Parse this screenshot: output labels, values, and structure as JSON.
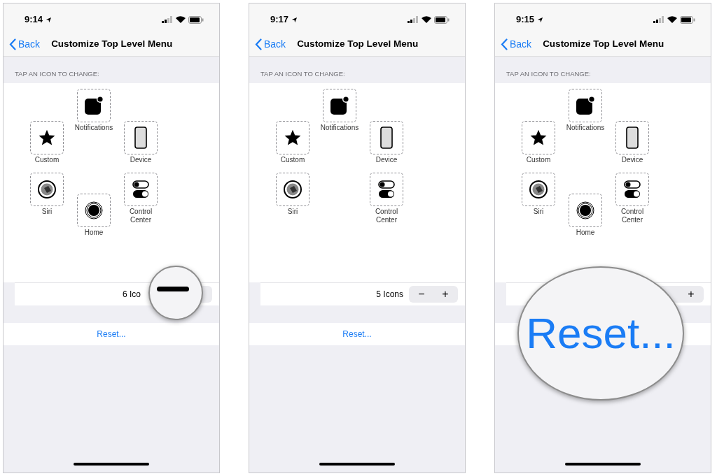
{
  "phones": [
    {
      "time": "9:14",
      "back": "Back",
      "title": "Customize Top Level Menu",
      "section_header": "TAP AN ICON TO CHANGE:",
      "icons": [
        {
          "kind": "notifications",
          "label": "Notifications"
        },
        {
          "kind": "custom",
          "label": "Custom"
        },
        {
          "kind": "device",
          "label": "Device"
        },
        {
          "kind": "siri",
          "label": "Siri"
        },
        {
          "kind": "control",
          "label": "Control Center"
        },
        {
          "kind": "home",
          "label": "Home"
        }
      ],
      "stepper": {
        "count": "6 Ico"
      },
      "reset": "Reset...",
      "magnifier": {
        "kind": "minus"
      }
    },
    {
      "time": "9:17",
      "back": "Back",
      "title": "Customize Top Level Menu",
      "section_header": "TAP AN ICON TO CHANGE:",
      "icons": [
        {
          "kind": "notifications",
          "label": "Notifications"
        },
        {
          "kind": "custom",
          "label": "Custom"
        },
        {
          "kind": "device",
          "label": "Device"
        },
        {
          "kind": "siri",
          "label": "Siri"
        },
        {
          "kind": "control",
          "label": "Control Center"
        }
      ],
      "stepper": {
        "count": "5 Icons",
        "minus": "−",
        "plus": "+"
      },
      "reset": "Reset..."
    },
    {
      "time": "9:15",
      "back": "Back",
      "title": "Customize Top Level Menu",
      "section_header": "TAP AN ICON TO CHANGE:",
      "icons": [
        {
          "kind": "notifications",
          "label": "Notifications"
        },
        {
          "kind": "custom",
          "label": "Custom"
        },
        {
          "kind": "device",
          "label": "Device"
        },
        {
          "kind": "siri",
          "label": "Siri"
        },
        {
          "kind": "control",
          "label": "Control Center"
        },
        {
          "kind": "home",
          "label": "Home"
        }
      ],
      "stepper": {
        "plus": "+"
      },
      "magnifier": {
        "kind": "text",
        "text": "Reset..."
      }
    }
  ]
}
